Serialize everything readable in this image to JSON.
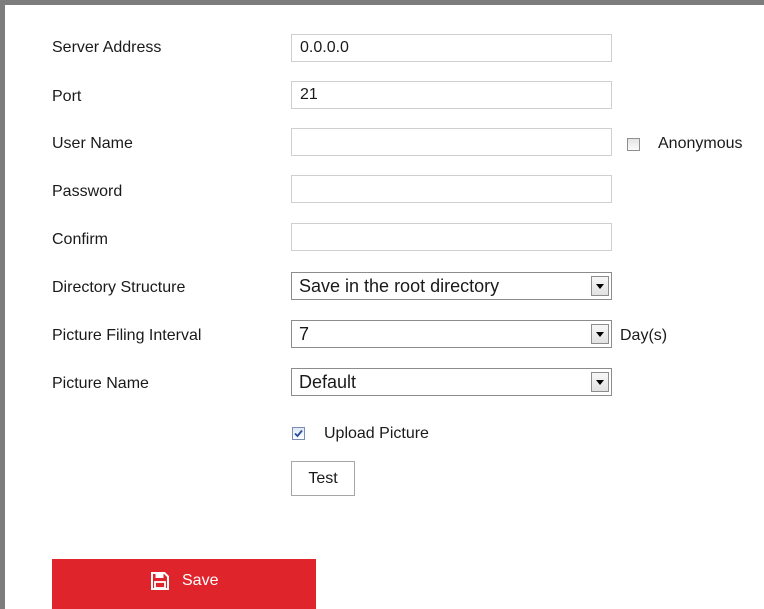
{
  "form": {
    "server_address": {
      "label": "Server Address",
      "value": "0.0.0.0"
    },
    "port": {
      "label": "Port",
      "value": "21"
    },
    "user_name": {
      "label": "User Name",
      "value": ""
    },
    "anonymous": {
      "label": "Anonymous",
      "checked": false
    },
    "password": {
      "label": "Password",
      "value": ""
    },
    "confirm": {
      "label": "Confirm",
      "value": ""
    },
    "directory_structure": {
      "label": "Directory Structure",
      "selected": "Save in the root directory"
    },
    "picture_filing_interval": {
      "label": "Picture Filing Interval",
      "selected": "7",
      "unit": "Day(s)"
    },
    "picture_name": {
      "label": "Picture Name",
      "selected": "Default"
    },
    "upload_picture": {
      "label": "Upload Picture",
      "checked": true
    },
    "test_button": "Test"
  },
  "footer": {
    "save_label": "Save",
    "save_icon": "floppy-disk-icon",
    "accent_color": "#e0242b"
  }
}
